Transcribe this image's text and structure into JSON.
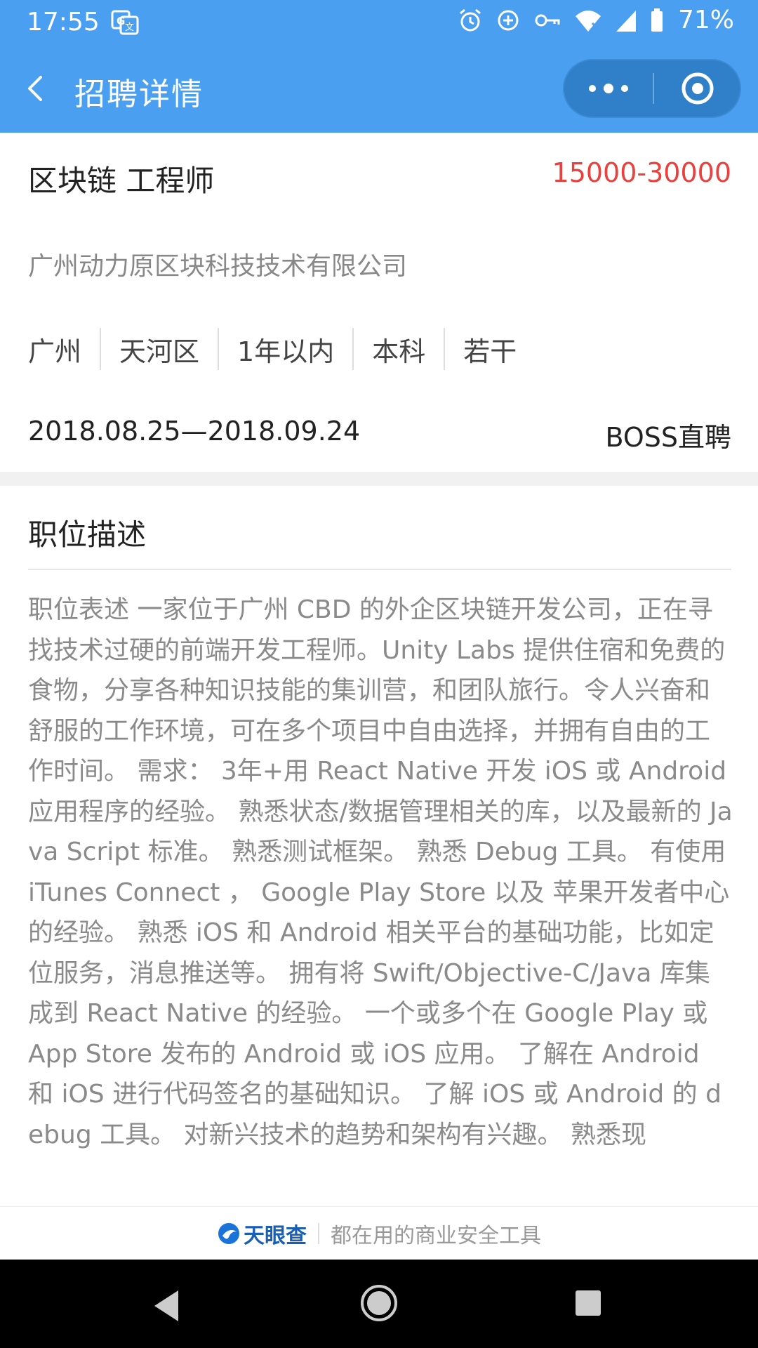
{
  "status_bar": {
    "time": "17:55",
    "battery": "71%",
    "icons": [
      "translate-icon",
      "alarm-icon",
      "data-saver-icon",
      "vpn-key-icon",
      "wifi-icon",
      "signal-icon",
      "battery-icon"
    ]
  },
  "navbar": {
    "title": "招聘详情",
    "back_icon": "chevron-left-icon",
    "more_icon": "more-dots-icon",
    "close_icon": "target-close-icon",
    "color": "#4a9ff0"
  },
  "job": {
    "title": "区块链 工程师",
    "salary": "15000-30000",
    "salary_color": "#e8413e",
    "company": "广州动力原区块科技技术有限公司",
    "tags": [
      "广州",
      "天河区",
      "1年以内",
      "本科",
      "若干"
    ],
    "dates": "2018.08.25—2018.09.24",
    "source": "BOSS直聘"
  },
  "description": {
    "heading": "职位描述",
    "body": "职位表述 一家位于广州 CBD 的外企区块链开发公司，正在寻找技术过硬的前端开发工程师。Unity Labs 提供住宿和免费的食物，分享各种知识技能的集训营，和团队旅行。令人兴奋和舒服的工作环境，可在多个项目中自由选择，并拥有自由的工作时间。 需求： 3年+用 React Native 开发 iOS 或 Android 应用程序的经验。 熟悉状态/数据管理相关的库，以及最新的 Java Script 标准。 熟悉测试框架。 熟悉 Debug 工具。 有使用 iTunes Connect ， Google Play Store 以及 苹果开发者中心的经验。 熟悉 iOS 和 Android 相关平台的基础功能，比如定位服务，消息推送等。 拥有将 Swift/Objective-C/Java 库集成到 React Native 的经验。 一个或多个在 Google Play 或 App Store 发布的 Android 或 iOS 应用。 了解在 Android 和 iOS 进行代码签名的基础知识。 了解 iOS 或 Android 的 debug 工具。 对新兴技术的趋势和架构有兴趣。 熟悉现"
  },
  "footer": {
    "brand": "天眼查",
    "slogan": "都在用的商业安全工具"
  },
  "system_nav": {
    "icons": [
      "back-triangle-icon",
      "home-circle-icon",
      "recents-square-icon"
    ]
  }
}
